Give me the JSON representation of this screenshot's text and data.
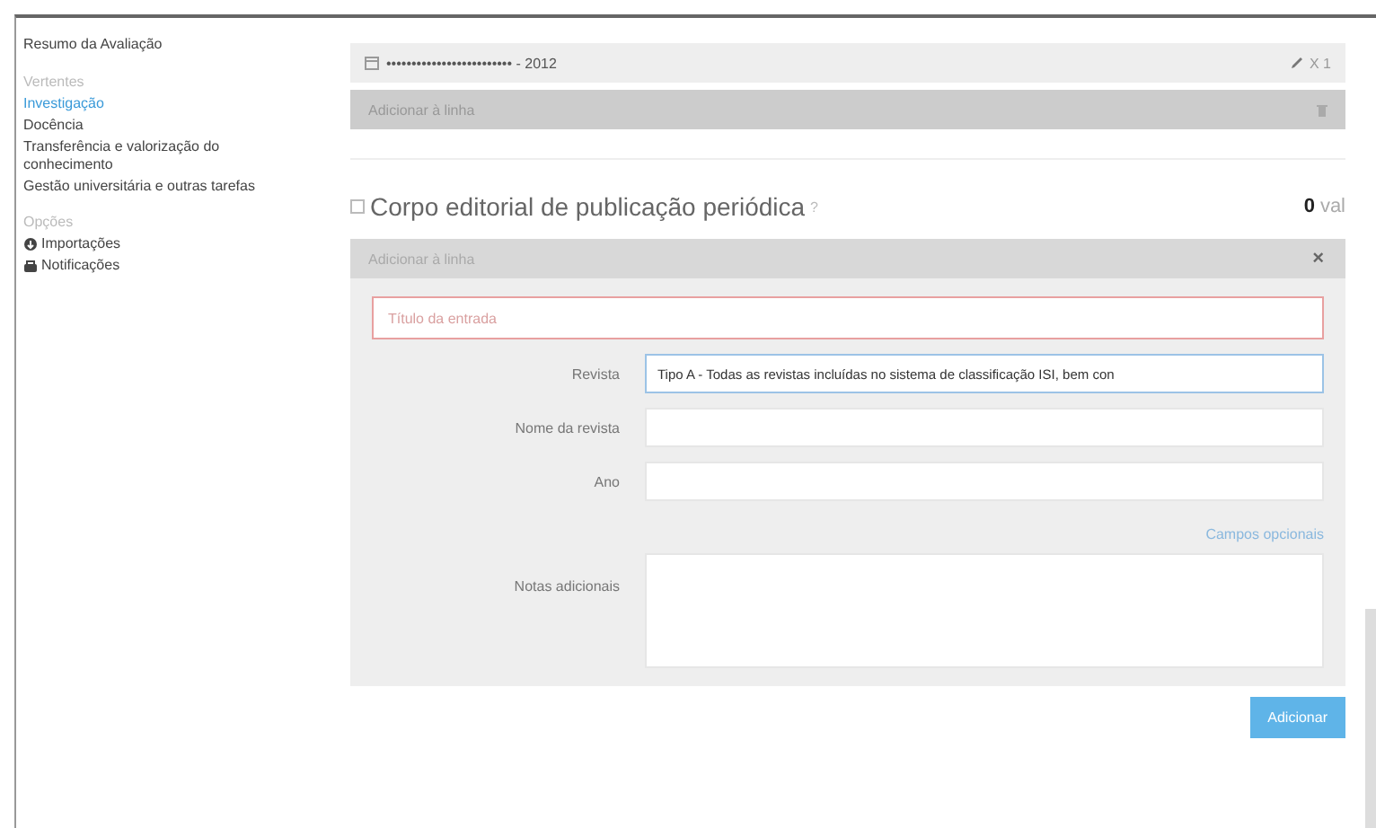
{
  "sidebar": {
    "title": "Resumo da Avaliação",
    "sections": [
      {
        "heading": "Vertentes",
        "items": [
          {
            "label": "Investigação",
            "selected": true
          },
          {
            "label": "Docência",
            "selected": false
          },
          {
            "label": "Transferência e valorização do conhecimento",
            "selected": false
          },
          {
            "label": "Gestão universitária e outras tarefas",
            "selected": false
          }
        ]
      },
      {
        "heading": "Opções",
        "items": [
          {
            "label": "Importações",
            "selected": false,
            "kind": "import"
          },
          {
            "label": "Notificações",
            "selected": false,
            "kind": "print"
          }
        ]
      }
    ]
  },
  "entry": {
    "title": "••••••••••••••••••••••••• - 2012",
    "count": "X 1"
  },
  "entry_bar": {
    "label": "Adicionar à linha"
  },
  "section": {
    "title": "Corpo editorial de publicação periódica",
    "help": "?",
    "score": "0",
    "unit": "val"
  },
  "form": {
    "header": "Adicionar à linha",
    "close": "×",
    "title_field": {
      "placeholder": "Título da entrada"
    },
    "fields": [
      {
        "label": "Revista",
        "kind": "select",
        "value": "Tipo A - Todas as revistas incluídas no sistema de classificação ISI, bem con"
      },
      {
        "label": "Nome da revista",
        "kind": "text"
      },
      {
        "label": "Ano",
        "kind": "text"
      }
    ],
    "optional_link": "Campos opcionais",
    "notes": {
      "label": "Notas adicionais"
    },
    "submit": "Adicionar"
  }
}
